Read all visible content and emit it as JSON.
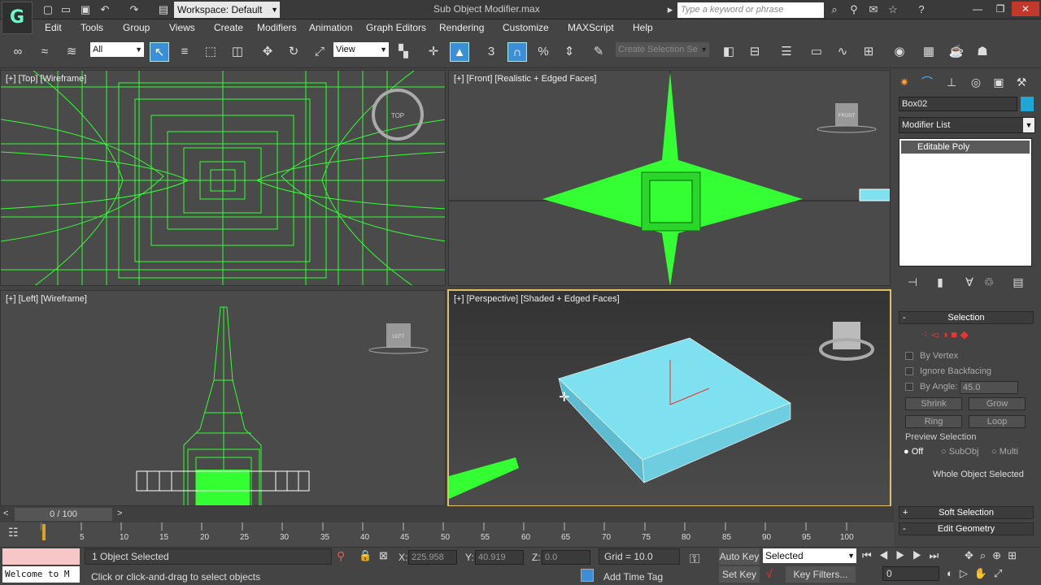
{
  "titlebar": {
    "logo": "G",
    "workspace": "Workspace: Default",
    "title": "Sub Object Modifier.max",
    "search_placeholder": "Type a keyword or phrase",
    "min": "—",
    "max": "❐",
    "close": "✕"
  },
  "menu": [
    "Edit",
    "Tools",
    "Group",
    "Views",
    "Create",
    "Modifiers",
    "Animation",
    "Graph Editors",
    "Rendering",
    "Customize",
    "MAXScript",
    "Help"
  ],
  "toolbar": {
    "filter": "All",
    "ref_coord": "View",
    "selection_set": "Create Selection Se"
  },
  "viewports": {
    "top": "[+] [Top] [Wireframe]",
    "front": "[+] [Front] [Realistic + Edged Faces]",
    "left": "[+] [Left] [Wireframe]",
    "perspective": "[+] [Perspective] [Shaded + Edged Faces]",
    "viewcube_top": "TOP",
    "viewcube_front": "FRONT",
    "viewcube_left": "LEFT"
  },
  "cmdpanel": {
    "object_name": "Box02",
    "modifier_list": "Modifier List",
    "stack_item": "Editable Poly",
    "selection_title": "Selection",
    "by_vertex": "By Vertex",
    "ignore_backfacing": "Ignore Backfacing",
    "by_angle": "By Angle:",
    "angle_value": "45.0",
    "shrink": "Shrink",
    "grow": "Grow",
    "ring": "Ring",
    "loop": "Loop",
    "preview_selection": "Preview Selection",
    "preview_off": "Off",
    "preview_subobj": "SubObj",
    "preview_multi": "Multi",
    "whole_object": "Whole Object Selected",
    "soft_selection": "Soft Selection",
    "edit_geometry": "Edit Geometry",
    "plus": "+",
    "minus": "-"
  },
  "timeline": {
    "frame_display": "0 / 100",
    "ticks": [
      "5",
      "10",
      "15",
      "20",
      "25",
      "30",
      "35",
      "40",
      "45",
      "50",
      "55",
      "60",
      "65",
      "70",
      "75",
      "80",
      "85",
      "90",
      "95",
      "100"
    ]
  },
  "status": {
    "maxscript": "Welcome to M",
    "objects_selected": "1 Object Selected",
    "prompt": "Click or click-and-drag to select objects",
    "x_label": "X:",
    "x_value": "225.958",
    "y_label": "Y:",
    "y_value": "40.919",
    "z_label": "Z:",
    "z_value": "0.0",
    "grid": "Grid = 10.0",
    "add_time_tag": "Add Time Tag",
    "auto_key": "Auto Key",
    "set_key": "Set Key",
    "selected": "Selected",
    "key_filters": "Key Filters...",
    "current_frame": "0"
  },
  "colors": {
    "wire_green": "#33ff33",
    "box_cyan": "#7fe0f0",
    "active_border": "#e0c060"
  }
}
